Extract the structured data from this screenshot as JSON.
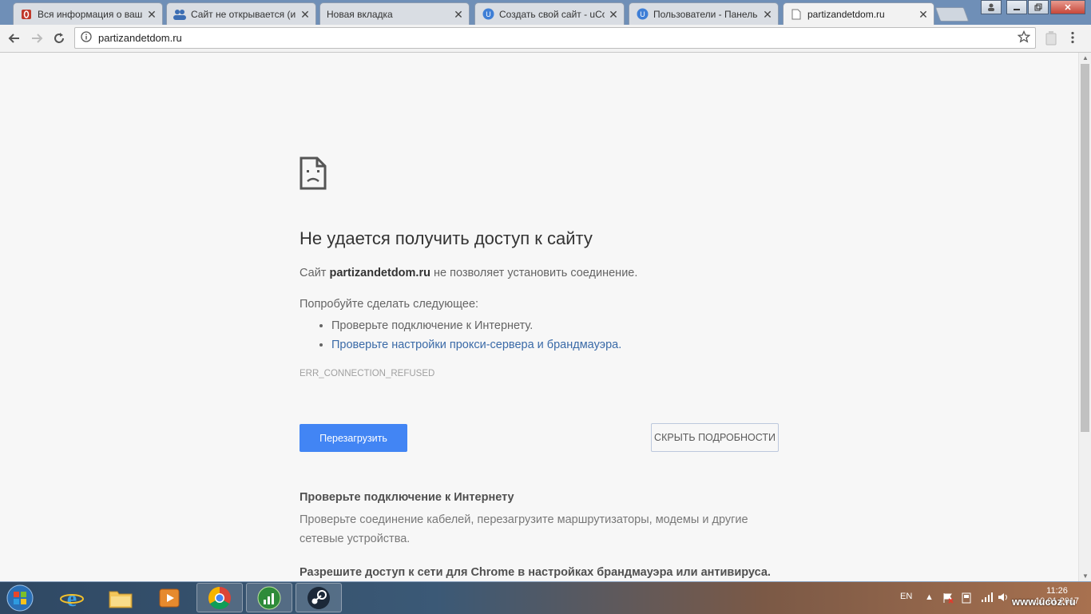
{
  "browser": {
    "tabs": [
      {
        "label": "Вся информация о ваш",
        "favicon": "opera-red-icon",
        "active": false
      },
      {
        "label": "Сайт не открывается (и",
        "favicon": "people-icon",
        "active": false
      },
      {
        "label": "Новая вкладка",
        "favicon": "",
        "active": false
      },
      {
        "label": "Создать свой сайт - uCo",
        "favicon": "ucoz-icon",
        "active": false
      },
      {
        "label": "Пользователи - Панель",
        "favicon": "ucoz-icon",
        "active": false
      },
      {
        "label": "partizandetdom.ru",
        "favicon": "page-icon",
        "active": true
      }
    ],
    "address_bar": {
      "url": "partizandetdom.ru"
    }
  },
  "error_page": {
    "title": "Не удается получить доступ к сайту",
    "description_prefix": "Сайт",
    "site": "partizandetdom.ru",
    "description_suffix": "не позволяет установить соединение.",
    "try_heading": "Попробуйте сделать следующее:",
    "suggestions": [
      "Проверьте подключение к Интернету.",
      "Проверьте настройки прокси-сервера и брандмауэра."
    ],
    "error_code": "ERR_CONNECTION_REFUSED",
    "reload_label": "Перезагрузить",
    "details_label": "СКРЫТЬ ПОДРОБНОСТИ",
    "detail_check_heading": "Проверьте подключение к Интернету",
    "detail_check_text": "Проверьте соединение кабелей, перезагрузите маршрутизаторы, модемы и другие сетевые устройства.",
    "detail_firewall_heading": "Разрешите доступ к сети для Chrome в настройках брандмауэра или антивируса."
  },
  "taskbar": {
    "language": "EN",
    "time": "11:26",
    "date": "10.01.2017",
    "watermark": "www.ucoz.ru",
    "apps": [
      "internet-explorer-icon",
      "folder-icon",
      "media-player-icon",
      "chrome-icon",
      "signal-app-icon",
      "steam-icon"
    ]
  },
  "colors": {
    "accent_button": "#4285f4",
    "link": "#3a6aa7"
  }
}
